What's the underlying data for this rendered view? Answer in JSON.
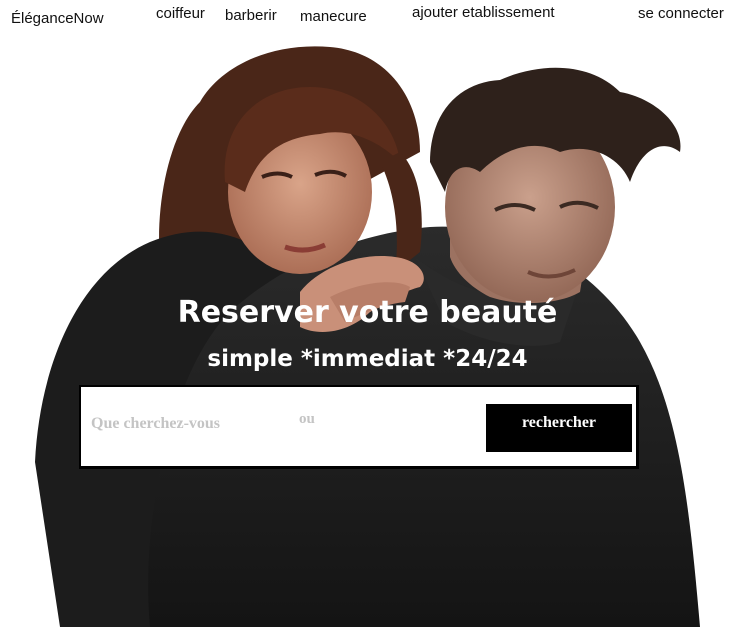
{
  "nav": {
    "brand": "ÉléganceNow",
    "links": [
      "coiffeur",
      "barberir",
      "manecure",
      "ajouter etablissement"
    ],
    "login": "se connecter"
  },
  "hero": {
    "image": "couple-portrait-photo",
    "title": "Reserver votre beauté",
    "subtitle": "simple *immediat *24/24"
  },
  "search": {
    "placeholder": "Que cherchez-vous",
    "separator": "ou",
    "button_label": "rechercher"
  },
  "colors": {
    "button_bg": "#000000",
    "headline": "#ffffff",
    "placeholder": "#c4c4c4"
  }
}
